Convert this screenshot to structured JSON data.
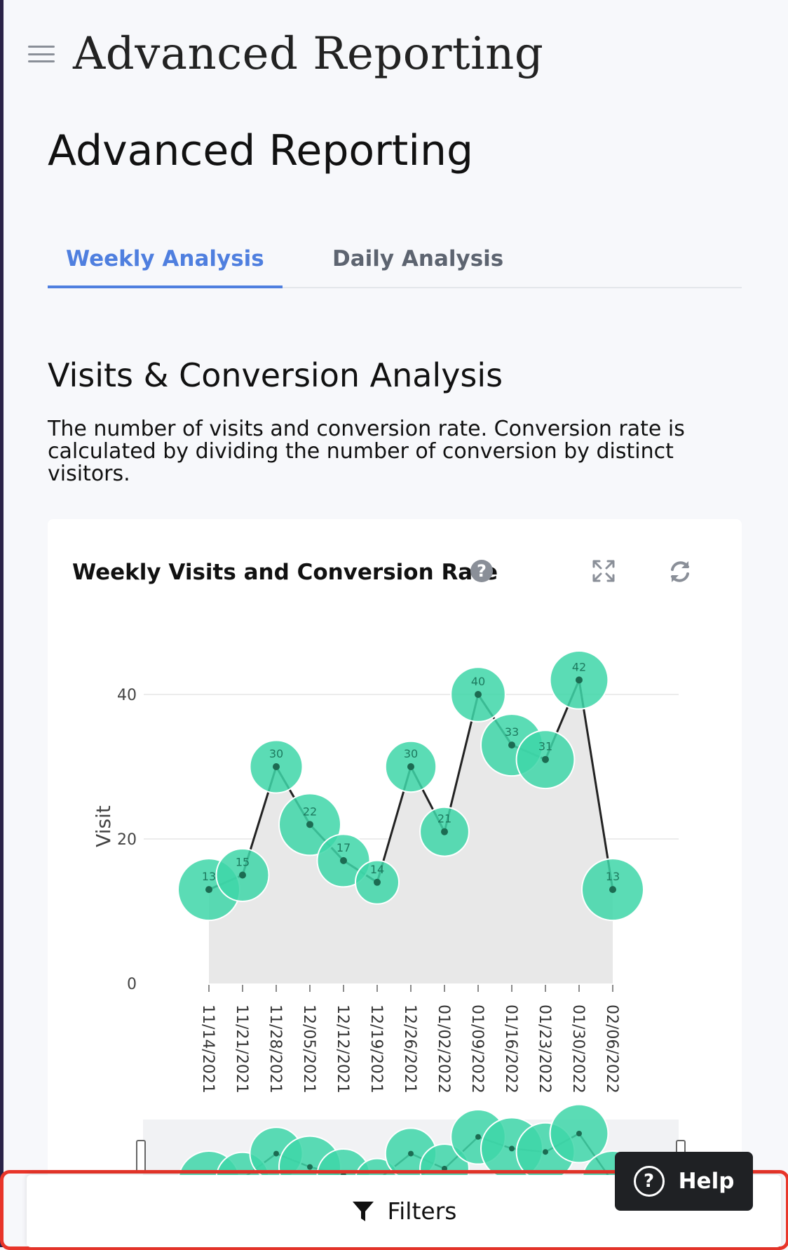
{
  "app": {
    "title": "Advanced Reporting"
  },
  "page": {
    "title": "Advanced Reporting"
  },
  "tabs": [
    {
      "label": "Weekly Analysis",
      "active": true
    },
    {
      "label": "Daily Analysis",
      "active": false
    }
  ],
  "section": {
    "title": "Visits & Conversion Analysis",
    "description": "The number of visits and conversion rate. Conversion rate is calculated by dividing the number of conversion by distinct visitors."
  },
  "card": {
    "title": "Weekly Visits and Conversion Rate",
    "help_icon_text": "?",
    "icons": [
      "expand-icon",
      "refresh-icon"
    ]
  },
  "chart_data": {
    "type": "line",
    "title": "Weekly Visits and Conversion Rate",
    "ylabel": "Visit",
    "xlabel": "",
    "ylim": [
      0,
      45
    ],
    "yticks": [
      0,
      20,
      40
    ],
    "grid": true,
    "categories": [
      "11/14/2021",
      "11/21/2021",
      "11/28/2021",
      "12/05/2021",
      "12/12/2021",
      "12/19/2021",
      "12/26/2021",
      "01/02/2022",
      "01/09/2022",
      "01/16/2022",
      "01/23/2022",
      "01/30/2022",
      "02/06/2022"
    ],
    "series": [
      {
        "values": [
          13,
          15,
          30,
          22,
          17,
          14,
          30,
          21,
          40,
          33,
          31,
          42,
          13
        ]
      }
    ],
    "bubble_relative_size": [
      1.0,
      0.75,
      0.75,
      1.0,
      0.75,
      0.5,
      0.7,
      0.65,
      0.8,
      1.0,
      0.9,
      0.9,
      1.0
    ],
    "colors": {
      "bubble": "#3ed6a8",
      "line": "#222222",
      "area": "#e8e8e8",
      "grid": "#e6e6e6"
    }
  },
  "footer": {
    "filters_label": "Filters",
    "help_label": "Help"
  }
}
